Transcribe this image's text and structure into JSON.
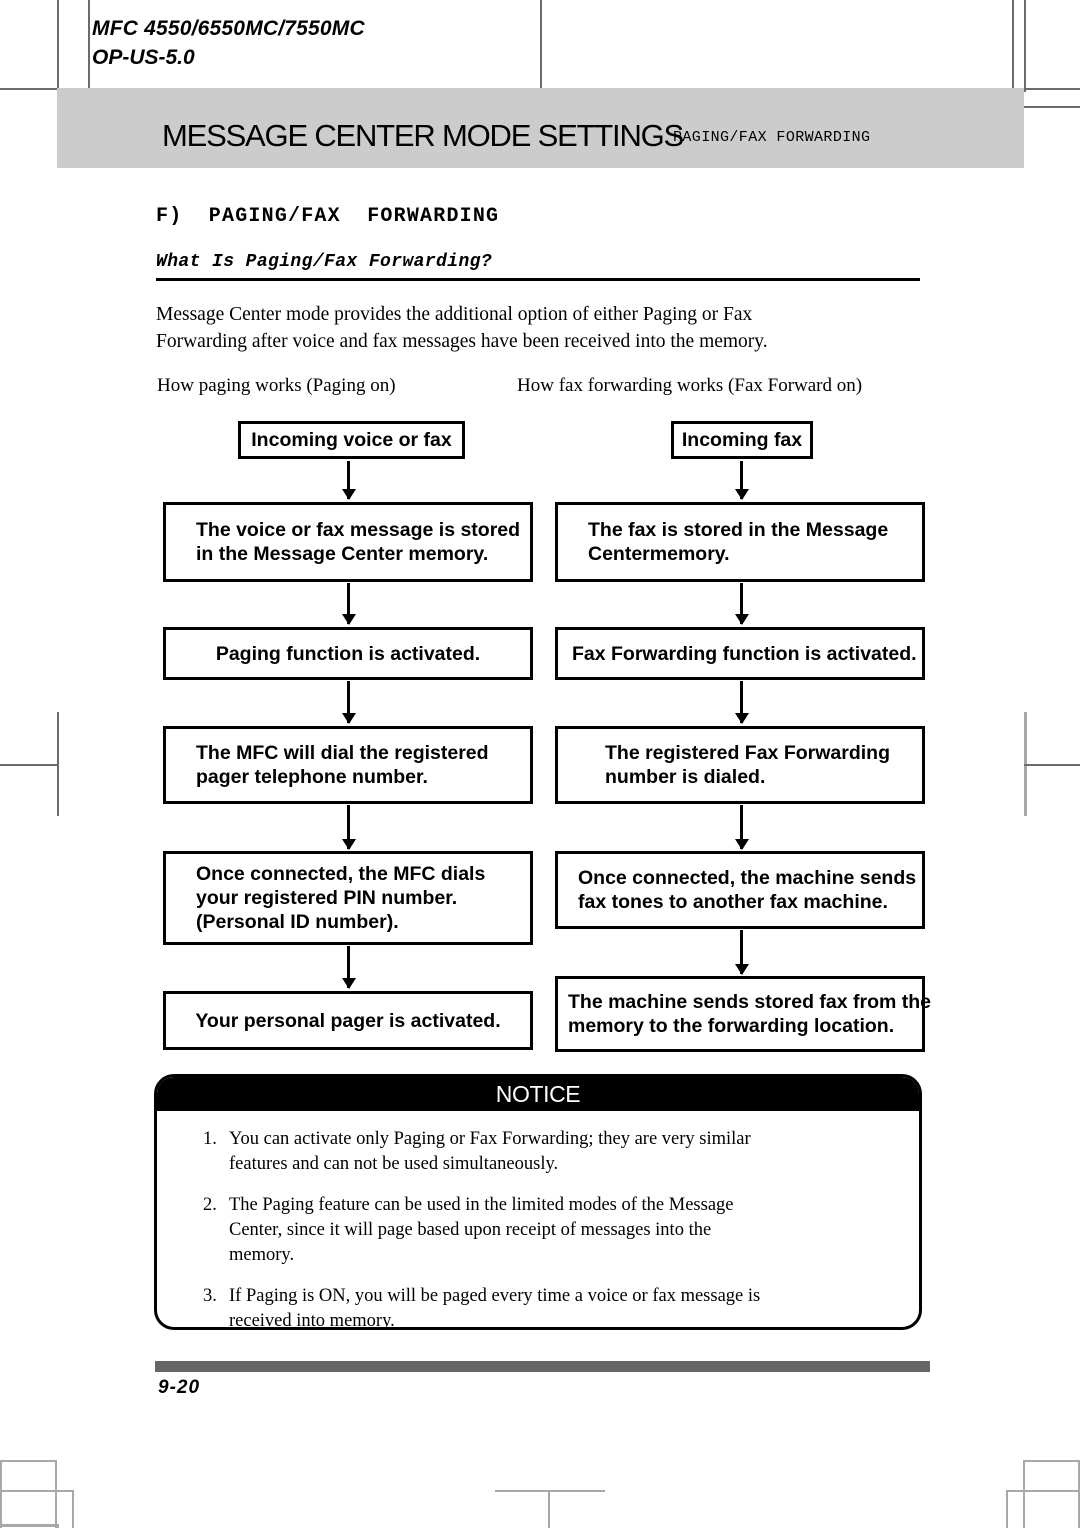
{
  "header": {
    "model_line": "MFC  4550/6550MC/7550MC",
    "doc_code": "OP-US-5.0",
    "band_title": "MESSAGE CENTER MODE SETTINGS",
    "band_subtitle": "PAGING/FAX FORWARDING"
  },
  "section": {
    "heading": "F)  PAGING/FAX  FORWARDING",
    "subheading": "What Is Paging/Fax Forwarding?",
    "paragraph_lines": [
      "Message Center mode provides the additional option of either Paging or Fax",
      "Forwarding after voice and fax messages have been received into the memory."
    ]
  },
  "flowcharts": {
    "left": {
      "caption": "How paging works (Paging on)",
      "steps": [
        {
          "lines": [
            "Incoming voice or fax"
          ]
        },
        {
          "lines": [
            "The voice or fax message is stored",
            "in the Message Center memory."
          ]
        },
        {
          "lines": [
            "Paging function is activated."
          ]
        },
        {
          "lines": [
            "The MFC will dial the registered",
            "pager telephone number."
          ]
        },
        {
          "lines": [
            "Once connected, the MFC dials",
            "your registered PIN number.",
            "(Personal ID number)."
          ]
        },
        {
          "lines": [
            "Your personal pager is activated."
          ]
        }
      ]
    },
    "right": {
      "caption": "How fax forwarding works (Fax Forward on)",
      "steps": [
        {
          "lines": [
            "Incoming fax"
          ]
        },
        {
          "lines": [
            "The fax is stored in the Message",
            "Centermemory."
          ]
        },
        {
          "lines": [
            "Fax Forwarding function is activated."
          ]
        },
        {
          "lines": [
            "The registered Fax Forwarding",
            "number is dialed."
          ]
        },
        {
          "lines": [
            "Once connected, the machine sends",
            "fax tones to another fax machine."
          ]
        },
        {
          "lines": [
            "The machine sends stored fax from the",
            "memory to the forwarding location."
          ]
        }
      ]
    }
  },
  "notice": {
    "title": "NOTICE",
    "items": [
      {
        "number": "1.",
        "lines": [
          "You can activate only Paging or Fax Forwarding; they are very similar",
          "features and can not be used simultaneously."
        ]
      },
      {
        "number": "2.",
        "lines": [
          "The Paging feature can be used in the limited modes of the Message",
          "Center, since it will page based upon receipt of messages into the",
          "memory."
        ]
      },
      {
        "number": "3.",
        "lines": [
          "If Paging is ON, you will be paged every time a voice or fax message is",
          "received into memory."
        ]
      }
    ]
  },
  "footer": {
    "page_number": "9-20"
  }
}
